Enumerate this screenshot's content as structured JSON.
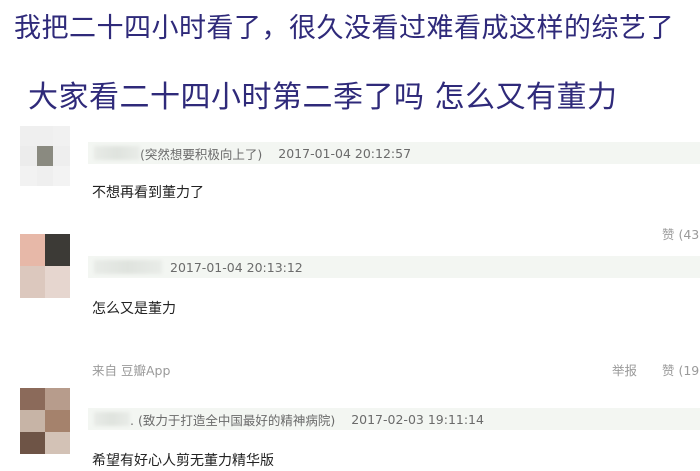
{
  "headlines": {
    "line1": "我把二十四小时看了，很久没看过难看成这样的综艺了",
    "line2": "大家看二十四小时第二季了吗 怎么又有董力"
  },
  "comments": [
    {
      "signature": "(突然想要积极向上了)",
      "timestamp": "2017-01-04 20:12:57",
      "text": "不想再看到董力了",
      "like": "赞 (43"
    },
    {
      "signature": "",
      "timestamp": "2017-01-04 20:13:12",
      "text": "怎么又是董力",
      "source": "来自 豆瓣App",
      "report": "举报",
      "like": "赞 (19"
    },
    {
      "signature": ". (致力于打造全中国最好的精神病院)",
      "timestamp": "2017-02-03 19:11:14",
      "text": "希望有好心人剪无董力精华版"
    }
  ],
  "colors": {
    "headline": "#2f2a7a",
    "meta_bar_bg": "#f3f6f2",
    "meta_text": "#6b6b6b",
    "footer_text": "#9a9a9a"
  }
}
